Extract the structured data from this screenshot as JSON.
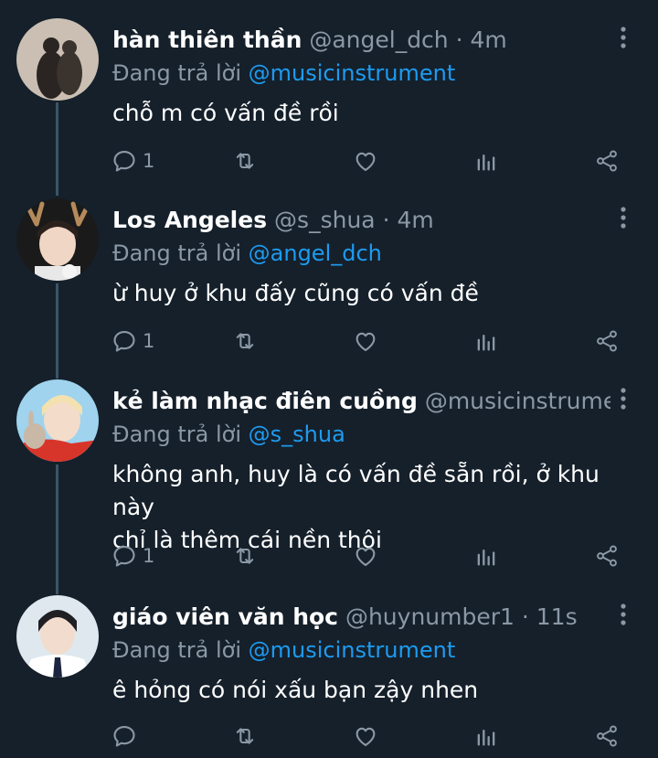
{
  "replying_prefix": "Đang trả lời",
  "tweets": [
    {
      "name": "hàn thiên thần",
      "handle": "@angel_dch",
      "time": "4m",
      "reply_to": "@musicinstrument",
      "lines": [
        "chỗ m có vấn đề rồi"
      ],
      "reply_count": "1"
    },
    {
      "name": "Los Angeles",
      "handle": "@s_shua",
      "time": "4m",
      "reply_to": "@angel_dch",
      "lines": [
        "ừ huy ở khu đấy cũng có vấn đề"
      ],
      "reply_count": "1"
    },
    {
      "name": "kẻ làm nhạc điên cuồng",
      "handle": "@musicinstrument …",
      "time": "",
      "reply_to": "@s_shua",
      "lines": [
        "không anh, huy là có vấn đề sẵn rồi, ở khu này",
        "chỉ là thêm cái nền thôi"
      ],
      "reply_count": "1"
    },
    {
      "name": "giáo viên văn học",
      "handle": "@huynumber1",
      "time": "11s",
      "reply_to": "@musicinstrument",
      "lines": [
        "ê hỏng có nói xấu bạn zậy nhen"
      ],
      "reply_count": ""
    }
  ],
  "colors": {
    "background": "#15202b",
    "text_primary": "#ffffff",
    "text_secondary": "#8b98a5",
    "mention": "#1d9bf0",
    "thread_line": "#3d5466"
  },
  "icons": [
    "more-icon",
    "reply-icon",
    "retweet-icon",
    "like-icon",
    "analytics-icon",
    "share-icon"
  ]
}
